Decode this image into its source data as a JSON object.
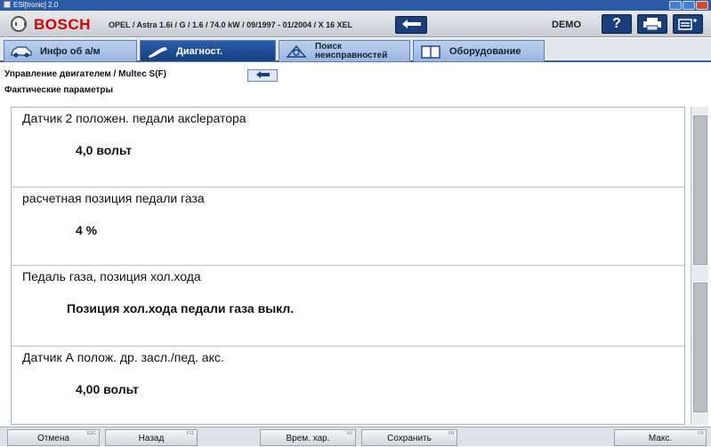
{
  "titlebar": {
    "title": "ESI[tronic] 2.0"
  },
  "header": {
    "brand": "BOSCH",
    "vehicle": "OPEL / Astra 1.6i / G / 1.6 / 74.0 kW / 09/1997 - 01/2004 / X 16 XEL",
    "demo_label": "DEMO",
    "help_label": "?",
    "icons": {
      "back": "back-arrow-icon",
      "help": "help-icon",
      "print": "printer-icon",
      "menu": "menu-icon"
    }
  },
  "tabs": [
    {
      "label": "Инфо об а/м",
      "icon": "car-icon",
      "active": false
    },
    {
      "label": "Диагност.",
      "icon": "diagnostic-probe-icon",
      "active": true
    },
    {
      "label_line1": "Поиск",
      "label_line2": "неисправностей",
      "icon": "troubleshoot-icon",
      "active": false
    },
    {
      "label": "Оборудование",
      "icon": "equipment-book-icon",
      "active": false
    }
  ],
  "breadcrumb": "Управление двигателем / Multec S(F)",
  "subtitle": "Фактические параметры",
  "parameters": [
    {
      "label": "Датчик 2 положен. педали аксleратора",
      "value": "4,0 вольт"
    },
    {
      "label": "расчетная позиция педали газа",
      "value": "4 %"
    },
    {
      "label": "Педаль газа, позиция хол.хода",
      "value": "Позиция хол.хода  педали газа выкл."
    },
    {
      "label": "Датчик А полож. др. засл./пед. акс.",
      "value": "4,00 вольт"
    }
  ],
  "footer": {
    "cancel": {
      "label": "Отмена",
      "key": "ESC"
    },
    "back": {
      "label": "Назад",
      "key": "F11"
    },
    "timechart": {
      "label": "Врем. хар.",
      "key": "F6"
    },
    "save": {
      "label": "Сохранить",
      "key": "F8"
    },
    "max": {
      "label": "Макс.",
      "key": "F9"
    }
  },
  "colors": {
    "brand_red": "#d50000",
    "accent_blue": "#1b3f7a",
    "tab_active": "#2a5cae"
  }
}
